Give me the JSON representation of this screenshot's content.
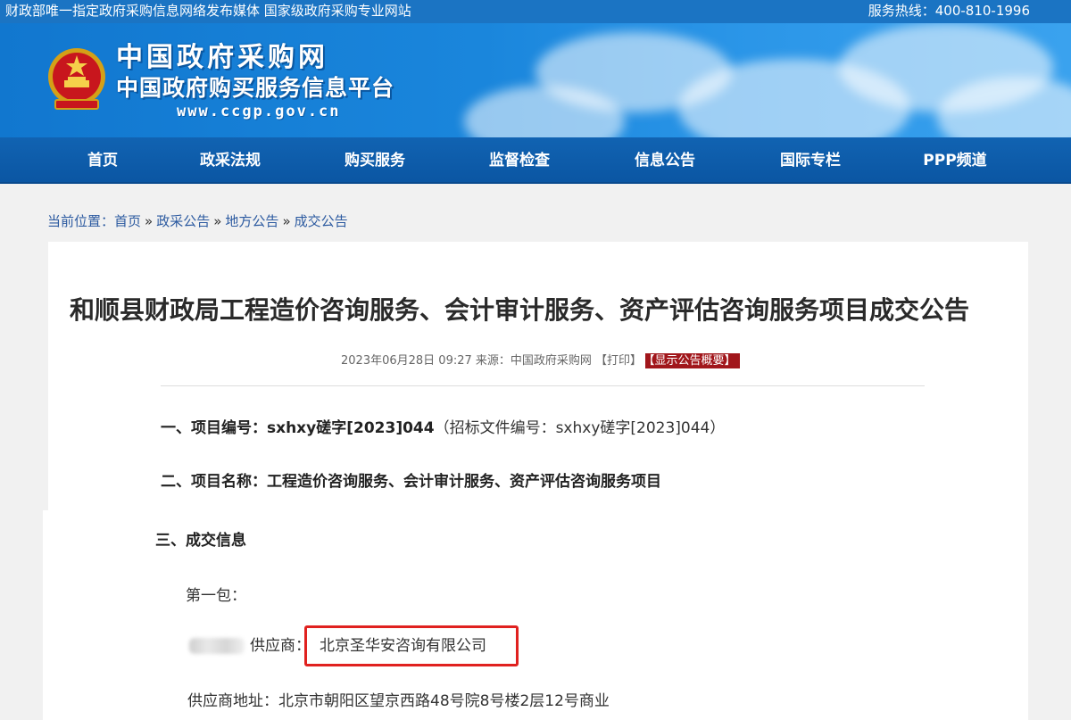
{
  "topbar": {
    "left_text": "财政部唯一指定政府采购信息网络发布媒体 国家级政府采购专业网站",
    "hotline": "服务热线：400-810-1996"
  },
  "brand": {
    "name": "中国政府采购网",
    "subtitle": "中国政府购买服务信息平台",
    "url": "www.ccgp.gov.cn"
  },
  "nav": {
    "items": [
      {
        "label": "首页"
      },
      {
        "label": "政采法规"
      },
      {
        "label": "购买服务"
      },
      {
        "label": "监督检查"
      },
      {
        "label": "信息公告"
      },
      {
        "label": "国际专栏"
      },
      {
        "label": "PPP频道"
      }
    ]
  },
  "breadcrumb": {
    "prefix": "当前位置：",
    "items": [
      "首页",
      "政采公告",
      "地方公告",
      "成交公告"
    ],
    "separator": "»"
  },
  "article": {
    "title": "和顺县财政局工程造价咨询服务、会计审计服务、资产评估咨询服务项目成交公告",
    "meta_text": "2023年06月28日 09:27 来源：中国政府采购网 【打印】",
    "meta_tag": "【显示公告概要】",
    "sec1_label": "一、项目编号：sxhxy磋字[2023]044",
    "sec1_note": "（招标文件编号：sxhxy磋字[2023]044）",
    "sec2": "二、项目名称：工程造价咨询服务、会计审计服务、资产评估咨询服务项目",
    "sec3": "三、成交信息",
    "package": "第一包：",
    "supplier_label": "供应商：",
    "supplier_name": "北京圣华安咨询有限公司",
    "supplier_address": "供应商地址：北京市朝阳区望京西路48号院8号楼2层12号商业"
  },
  "colors": {
    "nav_bg": "#0b56a3",
    "banner_bg": "#1a86dc",
    "highlight_box": "#e0211f",
    "tag_bg": "#a1161b"
  }
}
